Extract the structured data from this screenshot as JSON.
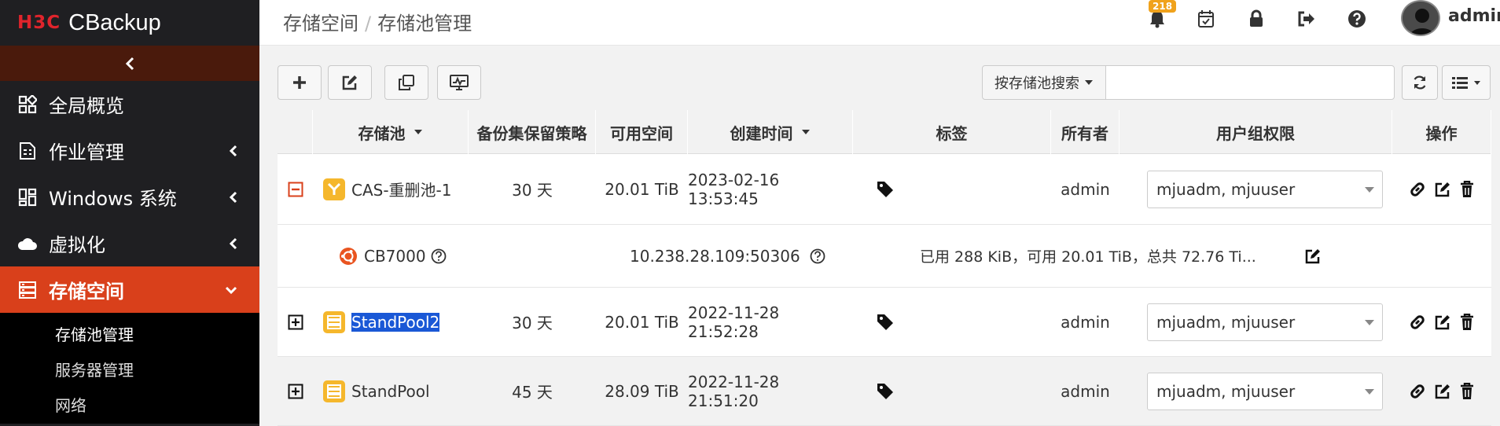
{
  "app": {
    "logo": "H3C",
    "name": "CBackup"
  },
  "sidebar": {
    "menu": [
      {
        "label": "全局概览",
        "icon": "dashboard-icon"
      },
      {
        "label": "作业管理",
        "icon": "job-icon"
      },
      {
        "label": "Windows 系统",
        "icon": "windows-icon"
      },
      {
        "label": "虚拟化",
        "icon": "cloud-icon"
      },
      {
        "label": "存储空间",
        "icon": "storage-icon"
      }
    ],
    "submenu": [
      {
        "label": "存储池管理"
      },
      {
        "label": "服务器管理"
      },
      {
        "label": "网络"
      }
    ]
  },
  "header": {
    "breadcrumb": [
      "存储空间",
      "存储池管理"
    ],
    "notification_count": "218",
    "user": "admin"
  },
  "toolbar": {
    "search_by": "按存储池搜索",
    "search_value": ""
  },
  "table": {
    "columns": {
      "pool": "存储池",
      "policy": "备份集保留策略",
      "free": "可用空间",
      "created": "创建时间",
      "tags": "标签",
      "owner": "所有者",
      "group_perm": "用户组权限",
      "actions": "操作"
    },
    "rows": [
      {
        "name": "CAS-重删池-1",
        "policy": "30 天",
        "free": "20.01 TiB",
        "created": "2023-02-16 13:53:45",
        "owner": "admin",
        "groups": "mjuadm, mjuuser"
      },
      {
        "name": "StandPool2",
        "policy": "30 天",
        "free": "20.01 TiB",
        "created": "2022-11-28 21:52:28",
        "owner": "admin",
        "groups": "mjuadm, mjuuser"
      },
      {
        "name": "StandPool",
        "policy": "45 天",
        "free": "28.09 TiB",
        "created": "2022-11-28 21:51:20",
        "owner": "admin",
        "groups": "mjuadm, mjuuser"
      }
    ],
    "detail": {
      "server": "CB7000",
      "address": "10.238.28.109:50306",
      "usage": "已用 288 KiB，可用 20.01 TiB，总共 72.76 Ti..."
    }
  },
  "colors": {
    "accent": "#d9401b",
    "sidebar": "#1f1f22",
    "badge": "#f0a21c",
    "pool_icon": "#f5b72c",
    "selection": "#1a58d6"
  }
}
